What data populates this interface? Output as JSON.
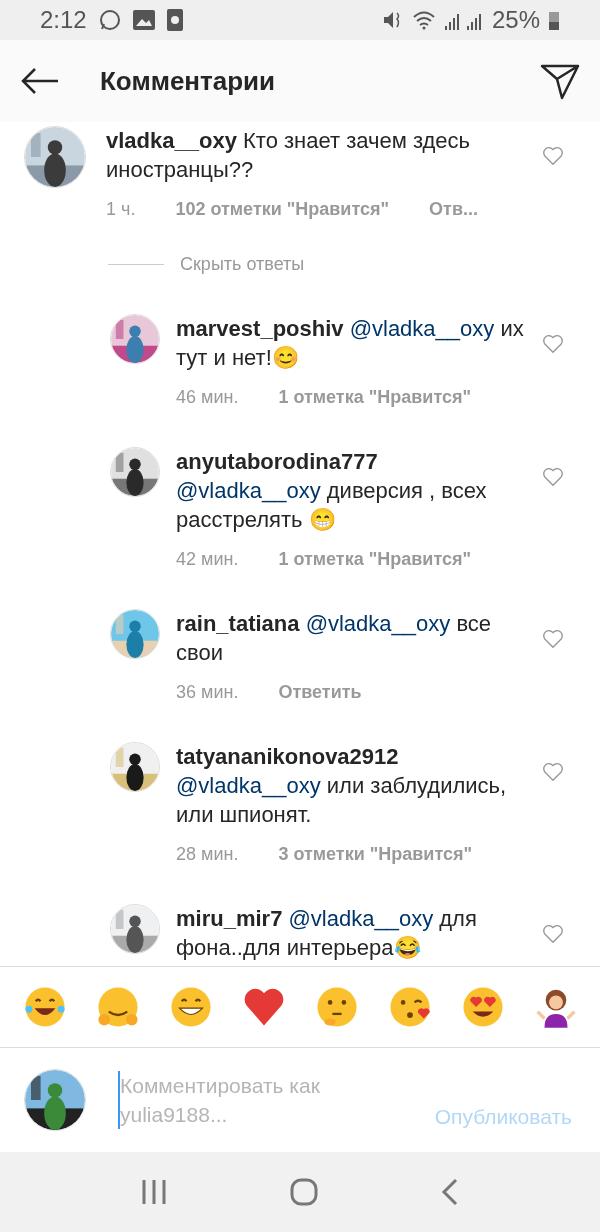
{
  "status_bar": {
    "time": "2:12",
    "battery": "25%"
  },
  "header": {
    "title": "Комментарии"
  },
  "comment": {
    "user": "vladka__oxy",
    "text": "Кто знает зачем здесь иностранцы??",
    "time": "1 ч.",
    "likes": "102 отметки \"Нравится\"",
    "reply": "Отв...",
    "liked": false
  },
  "hide_replies": "Скрыть ответы",
  "replies": [
    {
      "user": "marvest_poshiv",
      "mention": "@vladka__oxy",
      "text": "их тут и нет!😊",
      "time": "46 мин.",
      "likes": "1 отметка \"Нравится\"",
      "liked": false
    },
    {
      "user": "anyutaborodina777",
      "mention": "@vladka__oxy",
      "text": "диверсия , всех расстрелять 😁",
      "time": "42 мин.",
      "likes": "1 отметка \"Нравится\"",
      "liked": false
    },
    {
      "user": "rain_tatiana",
      "mention": "@vladka__oxy",
      "text": "все свои",
      "time": "36 мин.",
      "reply": "Ответить",
      "liked": false
    },
    {
      "user": "tatyananikonova2912",
      "mention": "@vladka__oxy",
      "text": " или заблудились, или шпионят.",
      "time": "28 мин.",
      "likes": "3 отметки \"Нравится\"",
      "liked": false
    },
    {
      "user": "miru_mir7",
      "mention": "@vladka__oxy",
      "text": "для фона..для интерьера😂",
      "liked": false
    }
  ],
  "composer": {
    "placeholder": "Комментировать как yulia9188...",
    "post": "Опубликовать"
  }
}
